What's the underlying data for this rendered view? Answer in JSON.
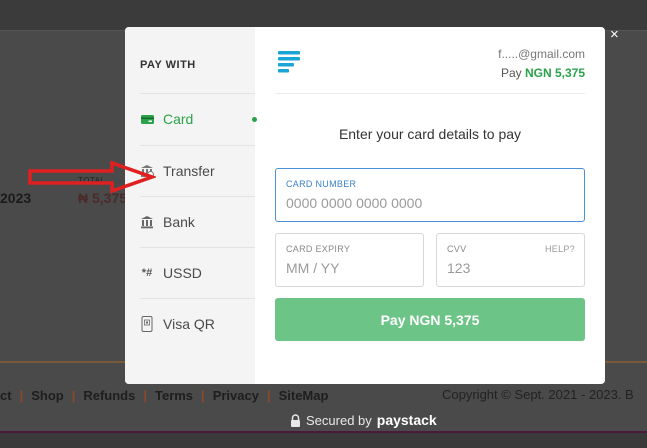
{
  "background": {
    "date_fragment": "2023",
    "total_label": "TOTAL",
    "total_value": "₦ 5,375",
    "footer_links": [
      "ct",
      "Shop",
      "Refunds",
      "Terms",
      "Privacy",
      "SiteMap"
    ],
    "copyright": "Copyright © Sept. 2021 - 2023. B"
  },
  "close_label": "×",
  "secured": {
    "text": "Secured by",
    "brand": "paystack",
    "icon": "lock-icon"
  },
  "sidebar": {
    "title": "PAY WITH",
    "methods": [
      {
        "label": "Card",
        "icon": "card-icon",
        "active": true
      },
      {
        "label": "Transfer",
        "icon": "bank-transfer-icon",
        "active": false
      },
      {
        "label": "Bank",
        "icon": "bank-icon",
        "active": false
      },
      {
        "label": "USSD",
        "icon": "ussd-icon",
        "active": false
      },
      {
        "label": "Visa QR",
        "icon": "qr-phone-icon",
        "active": false
      }
    ]
  },
  "header": {
    "email": "f.....@gmail.com",
    "pay_prefix": "Pay",
    "amount": "NGN 5,375",
    "logo_icon": "paystack-logo-icon"
  },
  "form": {
    "instruction": "Enter your card details to pay",
    "card_number": {
      "label": "CARD NUMBER",
      "placeholder": "0000 0000 0000 0000"
    },
    "card_expiry": {
      "label": "CARD EXPIRY",
      "placeholder": "MM / YY"
    },
    "cvv": {
      "label": "CVV",
      "help": "HELP?",
      "placeholder": "123"
    },
    "pay_button": "Pay NGN 5,375"
  },
  "colors": {
    "accent_green": "#2aa24a",
    "button_green": "#6cc486",
    "focus_blue": "#4a90d9",
    "annotation_red": "#e02020"
  }
}
